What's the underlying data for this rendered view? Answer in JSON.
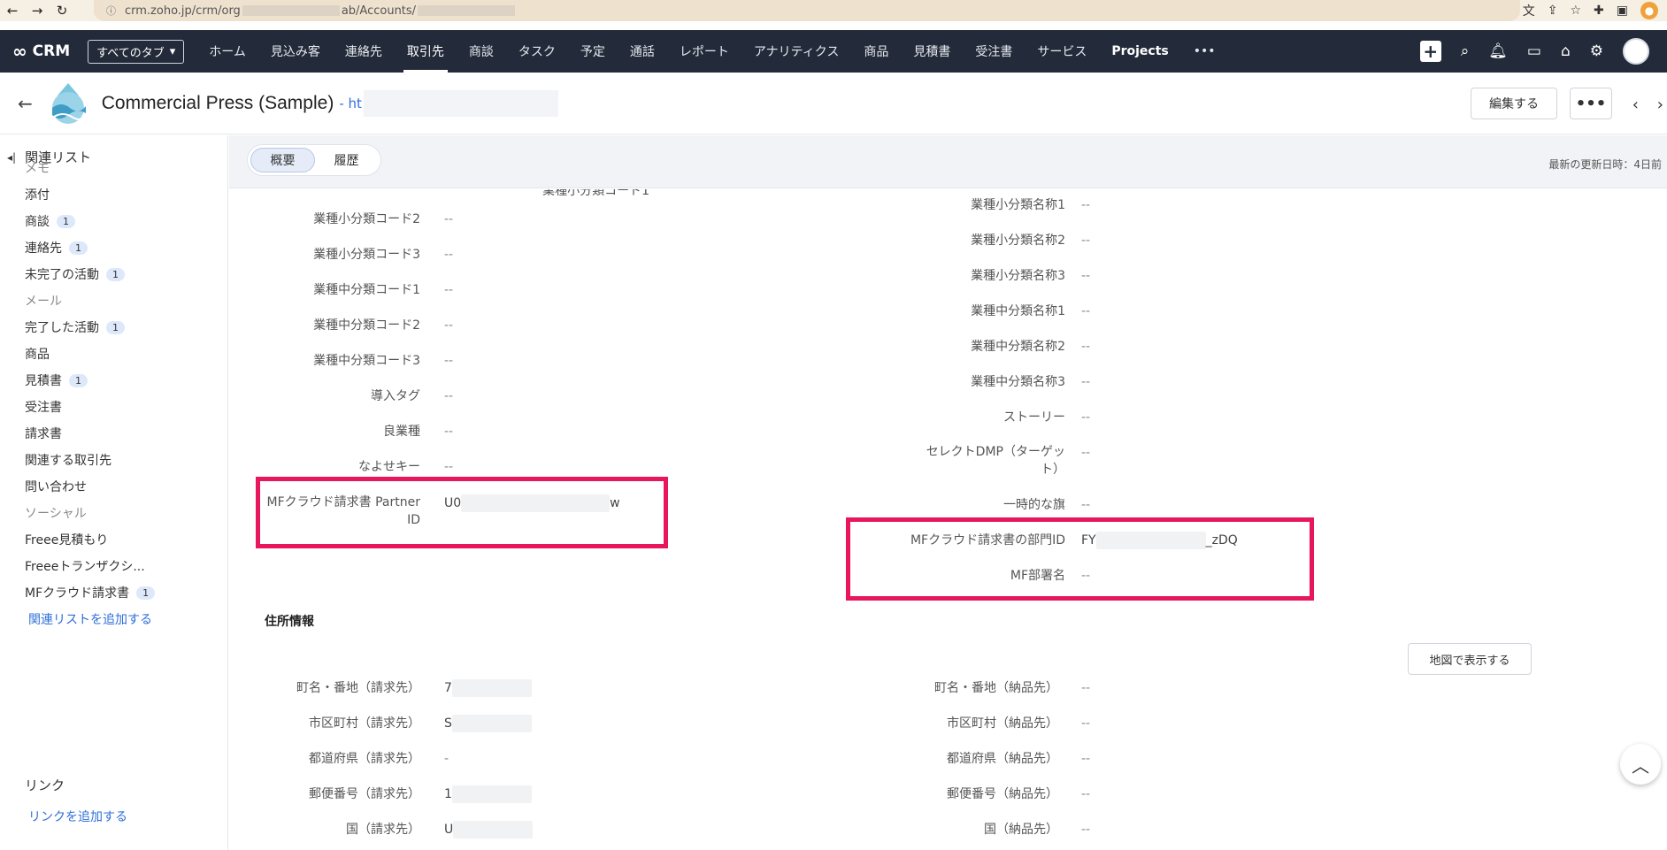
{
  "browser": {
    "back": "←",
    "forward": "→",
    "reload": "↻",
    "url_prefix": "crm.zoho.jp/crm/org",
    "url_middle": "ab/Accounts/",
    "profile_initial": "●"
  },
  "nav": {
    "app_name": "CRM",
    "all_tabs_label": "すべてのタブ",
    "items": [
      "ホーム",
      "見込み客",
      "連絡先",
      "取引先",
      "商談",
      "タスク",
      "予定",
      "通話",
      "レポート",
      "アナリティクス",
      "商品",
      "見積書",
      "受注書",
      "サービス",
      "Projects"
    ],
    "active_item": "取引先",
    "more": "•••"
  },
  "record": {
    "title": "Commercial Press (Sample)",
    "title_sep": " - ",
    "title_link": "ht",
    "edit_label": "編集する",
    "more_label": "•••"
  },
  "sidebar": {
    "header": "関連リスト",
    "items": [
      {
        "label": "メモ",
        "badge": "",
        "muted": true
      },
      {
        "label": "添付",
        "badge": "",
        "muted": false
      },
      {
        "label": "商談",
        "badge": "1",
        "muted": false
      },
      {
        "label": "連絡先",
        "badge": "1",
        "muted": false
      },
      {
        "label": "未完了の活動",
        "badge": "1",
        "muted": false
      },
      {
        "label": "メール",
        "badge": "",
        "muted": true
      },
      {
        "label": "完了した活動",
        "badge": "1",
        "muted": false
      },
      {
        "label": "商品",
        "badge": "",
        "muted": false
      },
      {
        "label": "見積書",
        "badge": "1",
        "muted": false
      },
      {
        "label": "受注書",
        "badge": "",
        "muted": false
      },
      {
        "label": "請求書",
        "badge": "",
        "muted": false
      },
      {
        "label": "関連する取引先",
        "badge": "",
        "muted": false
      },
      {
        "label": "問い合わせ",
        "badge": "",
        "muted": false
      },
      {
        "label": "ソーシャル",
        "badge": "",
        "muted": true
      },
      {
        "label": "Freee見積もり",
        "badge": "",
        "muted": false
      },
      {
        "label": "Freeeトランザクシ...",
        "badge": "",
        "muted": false
      },
      {
        "label": "MFクラウド請求書",
        "badge": "1",
        "muted": false
      }
    ],
    "add_related_list": "関連リストを追加する",
    "links_header": "リンク",
    "add_link": "リンクを追加する"
  },
  "tabs": {
    "overview": "概要",
    "history": "履歴",
    "last_updated": "最新の更新日時：4日前"
  },
  "left_fields": [
    {
      "label": "業種小分類コード2",
      "value": "--"
    },
    {
      "label": "業種小分類コード3",
      "value": "--"
    },
    {
      "label": "業種中分類コード1",
      "value": "--"
    },
    {
      "label": "業種中分類コード2",
      "value": "--"
    },
    {
      "label": "業種中分類コード3",
      "value": "--"
    },
    {
      "label": "導入タグ",
      "value": "--"
    },
    {
      "label": "良業種",
      "value": "--"
    },
    {
      "label": "なよせキー",
      "value": "--"
    }
  ],
  "mf_partner": {
    "label_line1": "MFクラウド請求書 Partner",
    "label_line2": "ID",
    "value_start": "U0",
    "value_end": "w"
  },
  "right_fields": [
    {
      "label": "業種小分類名称1",
      "value": "--"
    },
    {
      "label": "業種小分類名称2",
      "value": "--"
    },
    {
      "label": "業種小分類名称3",
      "value": "--"
    },
    {
      "label": "業種中分類名称1",
      "value": "--"
    },
    {
      "label": "業種中分類名称2",
      "value": "--"
    },
    {
      "label": "業種中分類名称3",
      "value": "--"
    },
    {
      "label": "ストーリー",
      "value": "--"
    }
  ],
  "select_dmp": {
    "label_line1": "セレクトDMP（ターゲッ",
    "label_line2": "ト）",
    "value": "--"
  },
  "temporary_flag": {
    "label": "一時的な旗",
    "value": "--"
  },
  "mf_department": {
    "id_label": "MFクラウド請求書の部門ID",
    "id_value_start": "FY",
    "id_value_end": "_zDQ",
    "name_label": "MF部署名",
    "name_value": "--"
  },
  "address": {
    "section_title": "住所情報",
    "map_button": "地図で表示する",
    "billing": [
      {
        "label": "町名・番地（請求先）",
        "value": "7"
      },
      {
        "label": "市区町村（請求先）",
        "value": "S"
      },
      {
        "label": "都道府県（請求先）",
        "value": "-"
      },
      {
        "label": "郵便番号（請求先）",
        "value": "1"
      },
      {
        "label": "国（請求先）",
        "value": "U"
      }
    ],
    "shipping": [
      {
        "label": "町名・番地（納品先）",
        "value": "--"
      },
      {
        "label": "市区町村（納品先）",
        "value": "--"
      },
      {
        "label": "都道府県（納品先）",
        "value": "--"
      },
      {
        "label": "郵便番号（納品先）",
        "value": "--"
      },
      {
        "label": "国（納品先）",
        "value": "--"
      }
    ]
  },
  "colors": {
    "nav_bg": "#232b3a",
    "highlight": "#e8175d",
    "link": "#2e6fd9"
  }
}
